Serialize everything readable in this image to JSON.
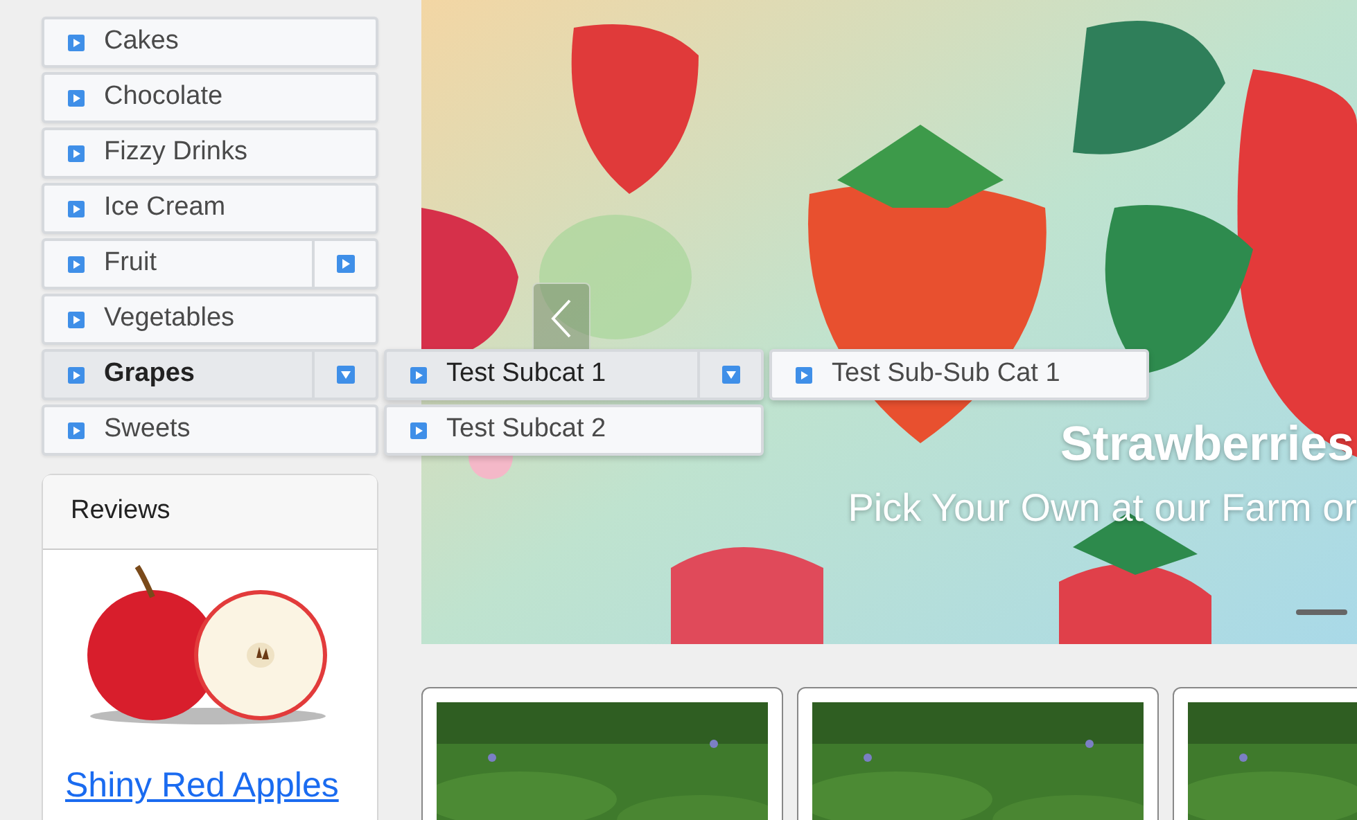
{
  "sidebar_menu": [
    {
      "label": "Cakes",
      "has_submenu": false,
      "expanded": false
    },
    {
      "label": "Chocolate",
      "has_submenu": false,
      "expanded": false
    },
    {
      "label": "Fizzy Drinks",
      "has_submenu": false,
      "expanded": false
    },
    {
      "label": "Ice Cream",
      "has_submenu": false,
      "expanded": false
    },
    {
      "label": "Fruit",
      "has_submenu": true,
      "expanded": false
    },
    {
      "label": "Vegetables",
      "has_submenu": false,
      "expanded": false
    },
    {
      "label": "Grapes",
      "has_submenu": true,
      "expanded": true,
      "children": [
        {
          "label": "Test Subcat 1",
          "has_submenu": true,
          "expanded": true,
          "children": [
            {
              "label": "Test Sub-Sub Cat 1",
              "has_submenu": false,
              "expanded": false
            }
          ]
        },
        {
          "label": "Test Subcat 2",
          "has_submenu": false,
          "expanded": false
        }
      ]
    },
    {
      "label": "Sweets",
      "has_submenu": false,
      "expanded": false
    }
  ],
  "reviews_card": {
    "header": "Reviews",
    "link": "Shiny Red Apples"
  },
  "carousel": {
    "caption_title": "Strawberries",
    "caption_text": "Pick Your Own at our Farm or",
    "indicators": [
      {
        "selected": true
      }
    ]
  }
}
